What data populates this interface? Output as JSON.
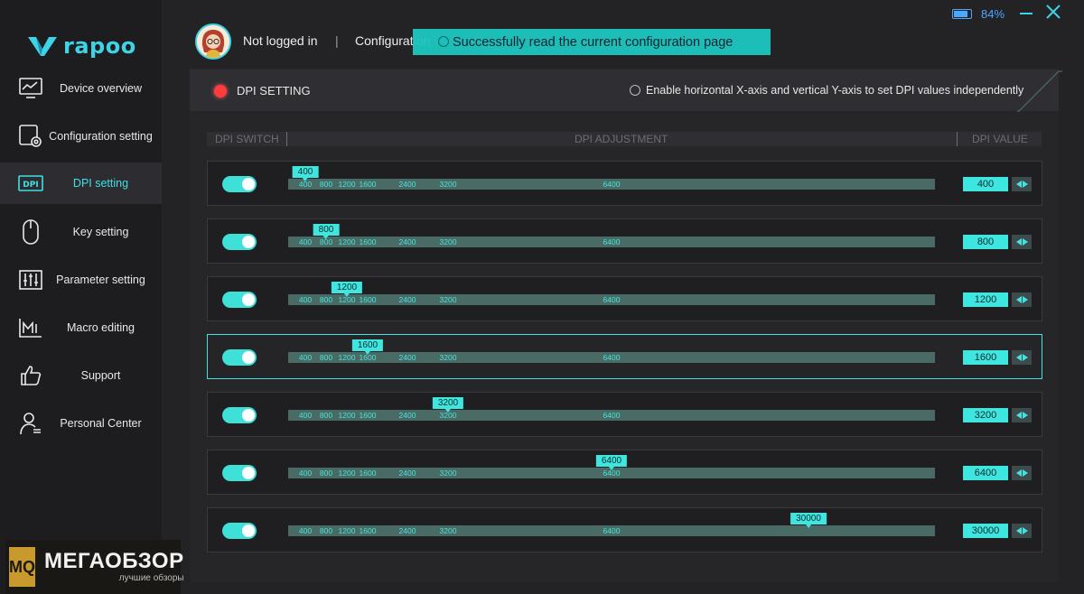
{
  "app": {
    "logo_text": "rapoo",
    "colors": {
      "accent": "#3fe0e6",
      "toast": "#1cc7bf",
      "record_dot": "#ff3b3b",
      "battery": "#4aa8ff"
    }
  },
  "sidebar": {
    "items": [
      {
        "label": "Device overview",
        "icon": "monitor-chart-icon",
        "active": false
      },
      {
        "label": "Configuration setting",
        "icon": "config-gear-icon",
        "active": false
      },
      {
        "label": "DPI setting",
        "icon": "dpi-icon",
        "active": true
      },
      {
        "label": "Key setting",
        "icon": "mouse-icon",
        "active": false
      },
      {
        "label": "Parameter setting",
        "icon": "sliders-icon",
        "active": false
      },
      {
        "label": "Macro editing",
        "icon": "macro-icon",
        "active": false
      },
      {
        "label": "Support",
        "icon": "thumbs-up-icon",
        "active": false
      },
      {
        "label": "Personal Center",
        "icon": "user-icon",
        "active": false
      }
    ]
  },
  "topbar": {
    "login_status": "Not logged in",
    "separator": "|",
    "config_label": "Configuration",
    "toast": "Successfully read the current configuration page",
    "battery": "84%",
    "battery_level": 0.84
  },
  "panel": {
    "title": "DPI SETTING",
    "xy_option": "Enable horizontal X-axis and vertical Y-axis to set DPI values independently",
    "columns": {
      "switch": "DPI SWITCH",
      "adjustment": "DPI ADJUSTMENT",
      "value": "DPI VALUE"
    }
  },
  "scale_ticks": [
    "400",
    "800",
    "1200",
    "1600",
    "2400",
    "3200",
    "6400"
  ],
  "dpi_rows": [
    {
      "enabled": true,
      "value": "400",
      "selected": false
    },
    {
      "enabled": true,
      "value": "800",
      "selected": false
    },
    {
      "enabled": true,
      "value": "1200",
      "selected": false
    },
    {
      "enabled": true,
      "value": "1600",
      "selected": true
    },
    {
      "enabled": true,
      "value": "3200",
      "selected": false
    },
    {
      "enabled": true,
      "value": "6400",
      "selected": false
    },
    {
      "enabled": true,
      "value": "30000",
      "selected": false
    }
  ],
  "watermark": {
    "badge": "MQ",
    "title": "МЕГАОБЗОР",
    "subtitle": "лучшие обзоры"
  }
}
